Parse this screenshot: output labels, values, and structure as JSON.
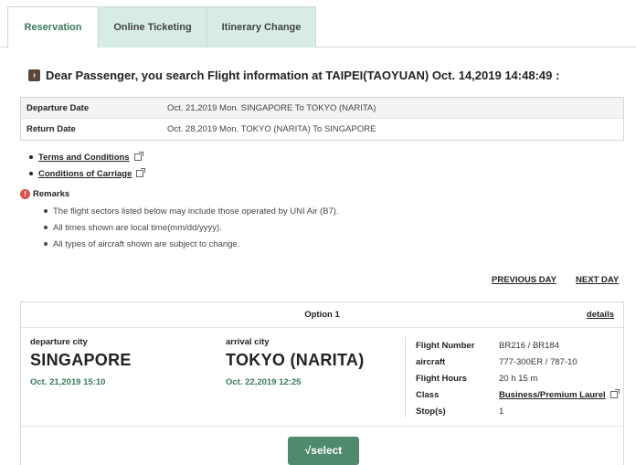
{
  "tabs": [
    {
      "label": "Reservation",
      "active": true
    },
    {
      "label": "Online Ticketing",
      "active": false
    },
    {
      "label": "Itinerary Change",
      "active": false
    }
  ],
  "headline": "Dear Passenger, you search Flight information at TAIPEI(TAOYUAN) Oct. 14,2019 14:48:49 :",
  "dates": {
    "departure_label": "Departure Date",
    "departure_value": "Oct. 21,2019 Mon. SINGAPORE To TOKYO (NARITA)",
    "return_label": "Return Date",
    "return_value": "Oct. 28,2019 Mon. TOKYO (NARITA) To SINGAPORE"
  },
  "links": {
    "terms": "Terms and Conditions",
    "carriage": "Conditions of Carriage"
  },
  "remarks": {
    "title": "Remarks",
    "items": [
      "The flight sectors listed below may include those operated by UNI Air (B7).",
      "All times shown are local time(mm/dd/yyyy).",
      "All types of aircraft shown are subject to change."
    ]
  },
  "nav": {
    "previous": "PREVIOUS DAY",
    "next": "NEXT DAY"
  },
  "option": {
    "title": "Option 1",
    "details": "details",
    "departure_label": "departure city",
    "departure_city": "SINGAPORE",
    "departure_time": "Oct. 21,2019 15:10",
    "arrival_label": "arrival city",
    "arrival_city": "TOKYO (NARITA)",
    "arrival_time": "Oct. 22,2019 12:25",
    "flight_number_label": "Flight Number",
    "flight_number": "BR216 / BR184",
    "aircraft_label": "aircraft",
    "aircraft": "777-300ER / 787-10",
    "hours_label": "Flight Hours",
    "hours": "20 h 15 m",
    "class_label": "Class",
    "class": "Business/Premium Laurel",
    "stops_label": "Stop(s)",
    "stops": "1",
    "select_label": "√select"
  },
  "colors": {
    "accent": "#3a7a5a",
    "tab_inactive": "#d7ede3",
    "button": "#4f8a6c"
  }
}
